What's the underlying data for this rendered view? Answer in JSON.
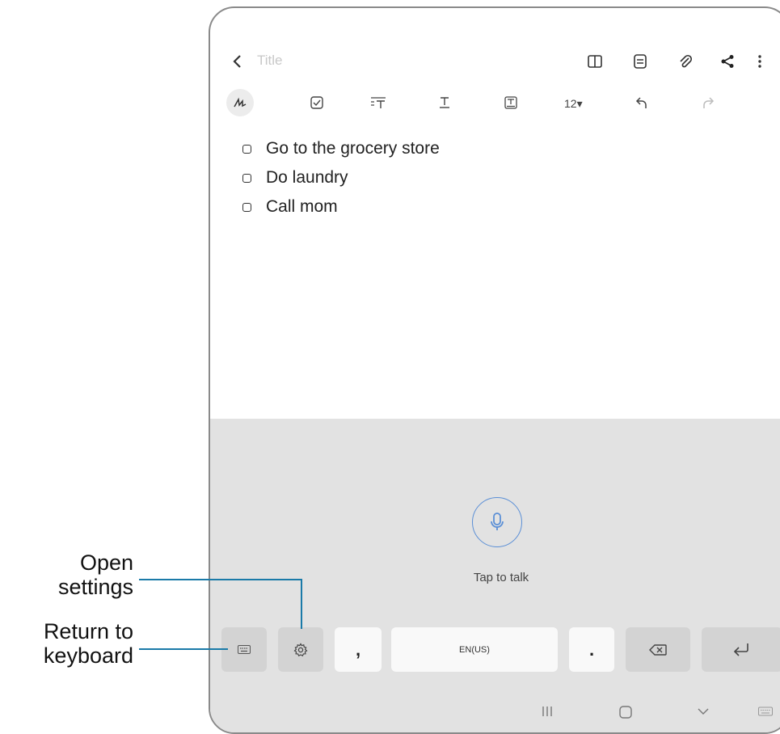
{
  "header": {
    "back_icon": "chevron-left-icon",
    "title_placeholder": "Title",
    "actions": [
      "book-icon",
      "note-icon",
      "attach-icon",
      "share-icon",
      "more-icon"
    ]
  },
  "toolbar": {
    "font_size": "12▾",
    "tools": [
      "handwriting-icon",
      "checkbox-icon",
      "text-style-icon",
      "text-format-icon",
      "text-box-icon",
      "undo-icon",
      "redo-icon"
    ]
  },
  "checklist": [
    {
      "label": "Go to the grocery store",
      "checked": false
    },
    {
      "label": "Do laundry",
      "checked": false
    },
    {
      "label": "Call mom",
      "checked": false
    }
  ],
  "voice": {
    "mic_icon": "microphone-icon",
    "prompt": "Tap to talk",
    "accent": "#5b8fd6"
  },
  "keyboard": {
    "comma": ",",
    "space_label": "EN(US)",
    "period": "."
  },
  "callouts": {
    "settings_line1": "Open",
    "settings_line2": "settings",
    "keyboard_line1": "Return to",
    "keyboard_line2": "keyboard",
    "line_color": "#1a7aa8"
  }
}
